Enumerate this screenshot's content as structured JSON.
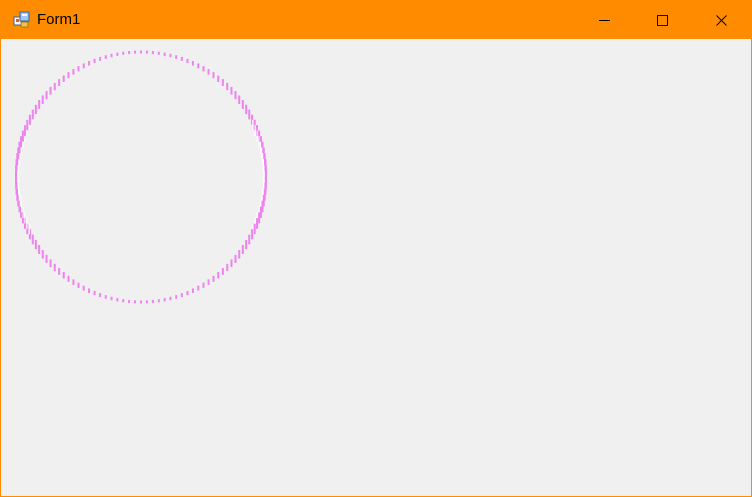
{
  "window": {
    "title": "Form1",
    "accent_color": "#ff8c00",
    "client_color": "#f0f0f0"
  },
  "title_bar": {
    "app_icon": "form-icon",
    "controls": [
      {
        "name": "minimize",
        "icon": "minimize-icon"
      },
      {
        "name": "maximize",
        "icon": "maximize-icon"
      },
      {
        "name": "close",
        "icon": "close-icon"
      }
    ]
  },
  "client": {
    "drawing": {
      "shape": "dashed-circle",
      "stroke_color": "#ee82ee",
      "highlight_color": "#ffffff"
    }
  }
}
